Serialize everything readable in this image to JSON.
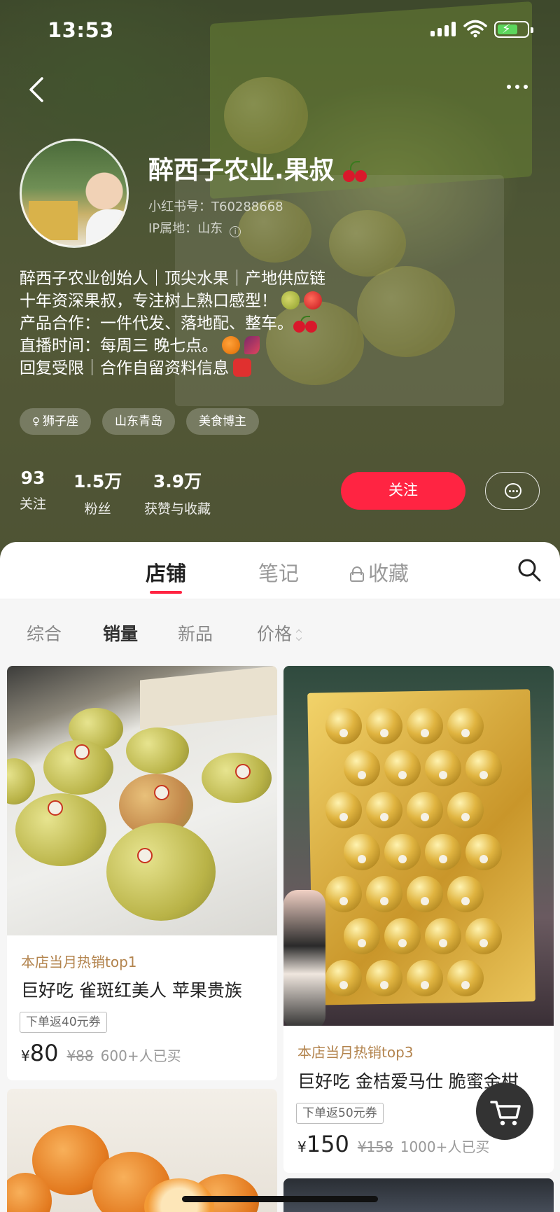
{
  "status_bar": {
    "time": "13:53"
  },
  "profile": {
    "name": "醉西子农业.果叔",
    "red_id": "小红书号：T60288668",
    "ip": "IP属地：山东",
    "bio": [
      "醉西子农业创始人｜顶尖水果｜产地供应链",
      "十年资深果叔，专注树上熟口感型！",
      "产品合作：一件代发、落地配、整车。",
      "直播时间：每周三 晚七点。",
      "回复受限｜合作自留资料信息"
    ],
    "tags": [
      {
        "icon": "female-symbol-icon",
        "label": "狮子座"
      },
      {
        "label": "山东青岛"
      },
      {
        "label": "美食博主"
      }
    ],
    "stats": [
      {
        "value": "93",
        "label": "关注"
      },
      {
        "value": "1.5万",
        "label": "粉丝"
      },
      {
        "value": "3.9万",
        "label": "获赞与收藏"
      }
    ],
    "follow_label": "关注"
  },
  "tabs": [
    "店铺",
    "笔记",
    "收藏"
  ],
  "filters": [
    "综合",
    "销量",
    "新品",
    "价格"
  ],
  "products": [
    {
      "hot": "本店当月热销top1",
      "title": "巨好吃 雀斑红美人 苹果贵族",
      "coupon": "下单返40元券",
      "currency": "¥",
      "price": "80",
      "original": "¥88",
      "sold": "600+人已买"
    },
    {
      "hot": "本店当月热销top3",
      "title": "巨好吃 金桔爱马仕 脆蜜金柑",
      "coupon": "下单返50元券",
      "currency": "¥",
      "price": "150",
      "original": "¥158",
      "sold": "1000+人已买"
    }
  ],
  "colors": {
    "brand_red": "#ff2442",
    "hot_text": "#b3844e"
  }
}
